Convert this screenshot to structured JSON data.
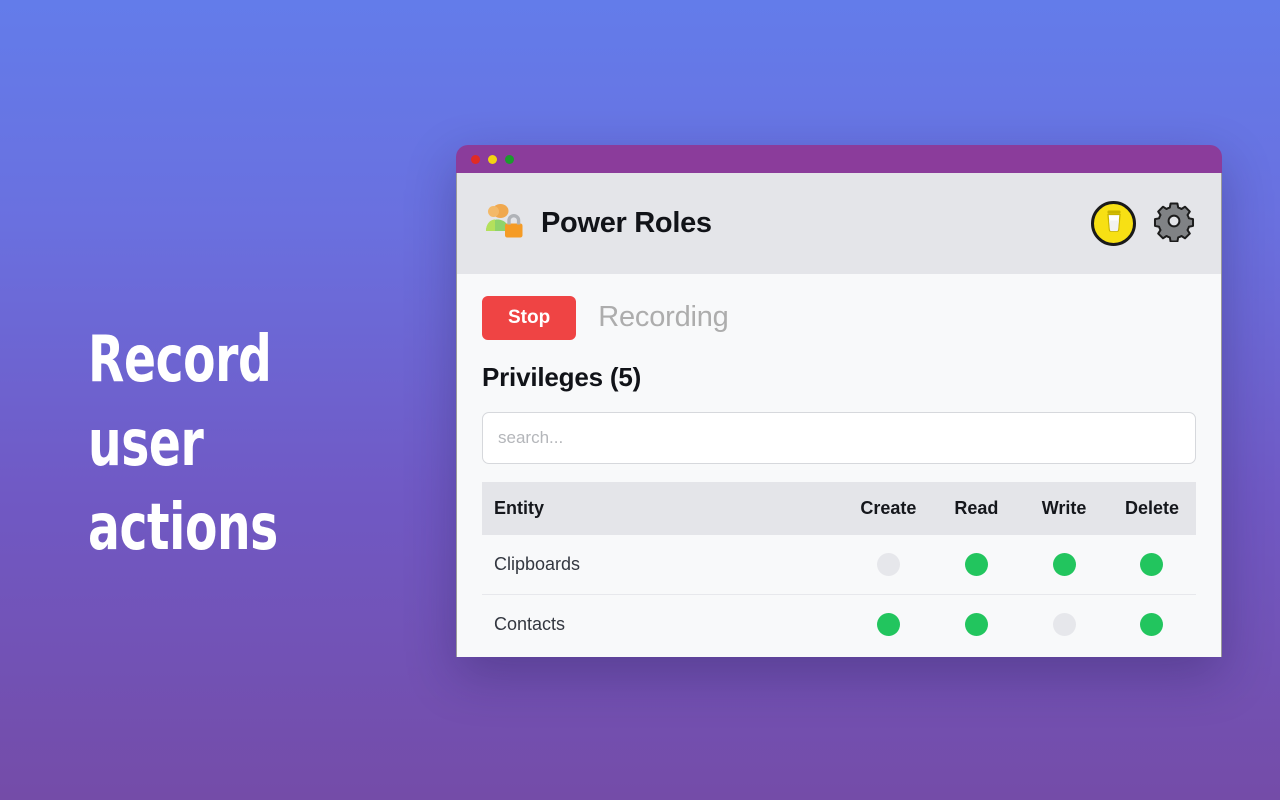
{
  "page": {
    "headline": "Record user\nactions",
    "background_top_color": "#637CEA",
    "background_bottom_color": "#744CA8"
  },
  "window": {
    "titlebar_color": "#8B3C9B",
    "traffic_lights": [
      "red",
      "yellow",
      "green"
    ]
  },
  "app": {
    "brand_title": "Power Roles",
    "logo_icon": "users-lock-icon",
    "actions": [
      {
        "name": "buy-me-a-coffee-button",
        "icon": "coffee-cup-icon",
        "color": "#F7E014"
      },
      {
        "name": "settings-button",
        "icon": "gear-icon",
        "color": "#808080"
      }
    ]
  },
  "recorder": {
    "stop_label": "Stop",
    "stop_color": "#EF4444",
    "status_label": "Recording"
  },
  "privileges": {
    "title": "Privileges (5)",
    "count": 5,
    "search_placeholder": "search...",
    "search_value": "",
    "columns": [
      "Entity",
      "Create",
      "Read",
      "Write",
      "Delete"
    ],
    "on_color": "#22C55E",
    "off_color": "#E6E7EB",
    "rows": [
      {
        "entity": "Clipboards",
        "create": false,
        "read": true,
        "write": true,
        "delete": true
      },
      {
        "entity": "Contacts",
        "create": true,
        "read": true,
        "write": false,
        "delete": true
      }
    ]
  }
}
